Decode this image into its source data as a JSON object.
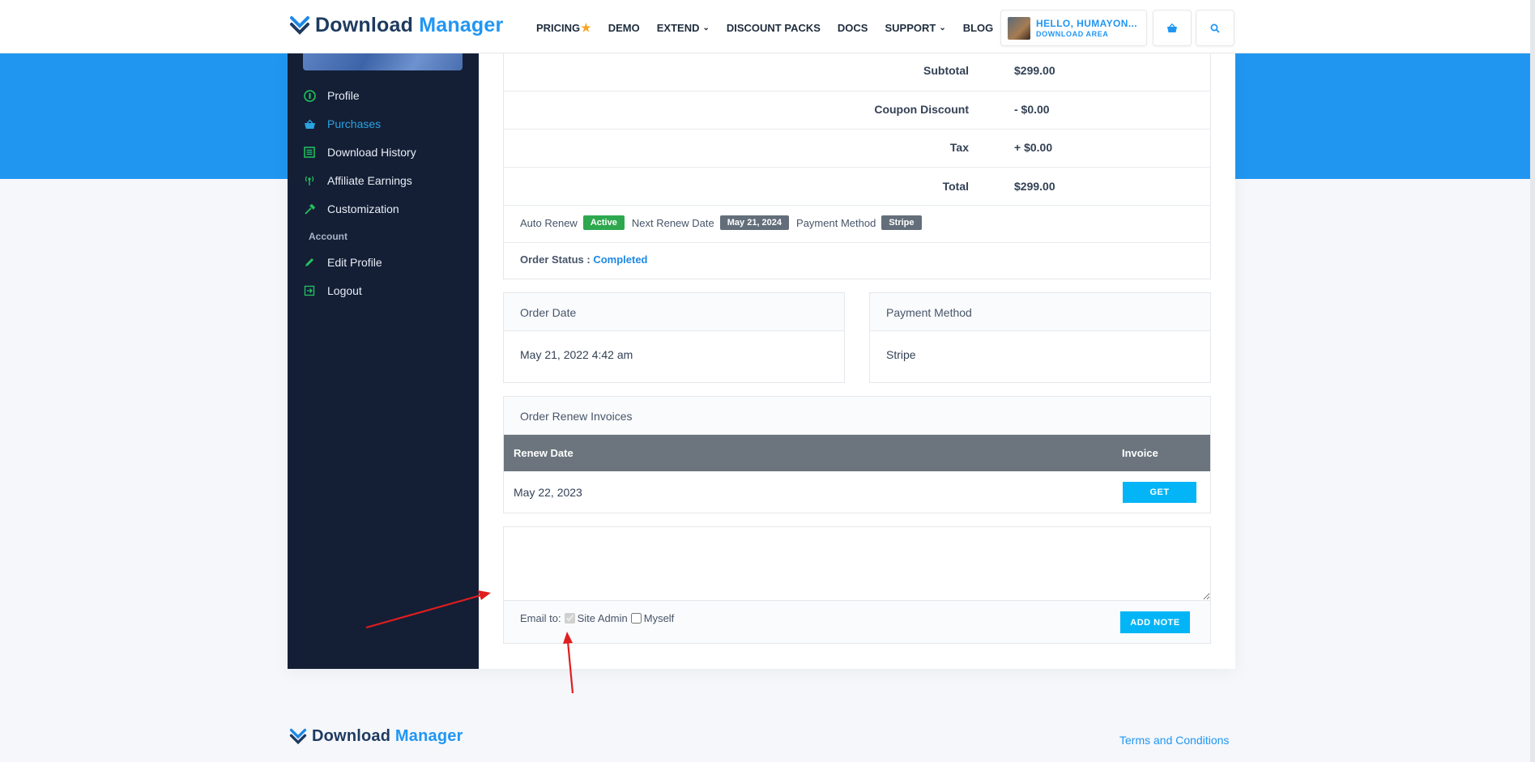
{
  "brand": {
    "name_part1": "Download",
    "name_part2": "Manager"
  },
  "nav": {
    "items": [
      {
        "label": "PRICING",
        "has_star": true
      },
      {
        "label": "DEMO"
      },
      {
        "label": "EXTEND",
        "has_chevron": true
      },
      {
        "label": "DISCOUNT PACKS"
      },
      {
        "label": "DOCS"
      },
      {
        "label": "SUPPORT",
        "has_chevron": true
      },
      {
        "label": "BLOG"
      }
    ],
    "user_greeting": "HELLO, HUMAYON...",
    "user_sub": "DOWNLOAD AREA",
    "icons": [
      "basket-icon",
      "search-icon"
    ]
  },
  "sidebar": {
    "items": [
      {
        "label": "Profile",
        "icon": "profile-icon"
      },
      {
        "label": "Purchases",
        "icon": "basket-icon",
        "active": true
      },
      {
        "label": "Download History",
        "icon": "list-icon"
      },
      {
        "label": "Affiliate Earnings",
        "icon": "broadcast-icon"
      },
      {
        "label": "Customization",
        "icon": "hammer-icon"
      }
    ],
    "section_label": "Account",
    "account_items": [
      {
        "label": "Edit Profile",
        "icon": "pencil-icon"
      },
      {
        "label": "Logout",
        "icon": "logout-icon"
      }
    ]
  },
  "totals": {
    "rows": [
      {
        "label": "Subtotal",
        "value": "$299.00"
      },
      {
        "label": "Coupon Discount",
        "value": "- $0.00"
      },
      {
        "label": "Tax",
        "value": "+ $0.00"
      },
      {
        "label": "Total",
        "value": "$299.00"
      }
    ],
    "auto_renew_label": "Auto Renew",
    "auto_renew_value": "Active",
    "next_renew_label": "Next Renew Date",
    "next_renew_value": "May 21, 2024",
    "payment_method_label": "Payment Method",
    "payment_method_value": "Stripe",
    "order_status_label": "Order Status :",
    "order_status_value": "Completed"
  },
  "order_date": {
    "title": "Order Date",
    "value": "May 21, 2022 4:42 am"
  },
  "payment_method": {
    "title": "Payment Method",
    "value": "Stripe"
  },
  "invoices": {
    "title": "Order Renew Invoices",
    "col_renew_date": "Renew Date",
    "col_invoice": "Invoice",
    "rows": [
      {
        "renew_date": "May 22, 2023",
        "button": "GET"
      }
    ]
  },
  "note": {
    "email_to_label": "Email to:",
    "site_admin_label": "Site Admin",
    "myself_label": "Myself",
    "add_note_button": "ADD NOTE"
  },
  "footer": {
    "terms_link": "Terms and Conditions"
  },
  "colors": {
    "accent": "#2196f3",
    "sidebar": "#141f36",
    "button": "#03b5f6",
    "success": "#2ea84f",
    "annotation": "#e11d1d"
  }
}
